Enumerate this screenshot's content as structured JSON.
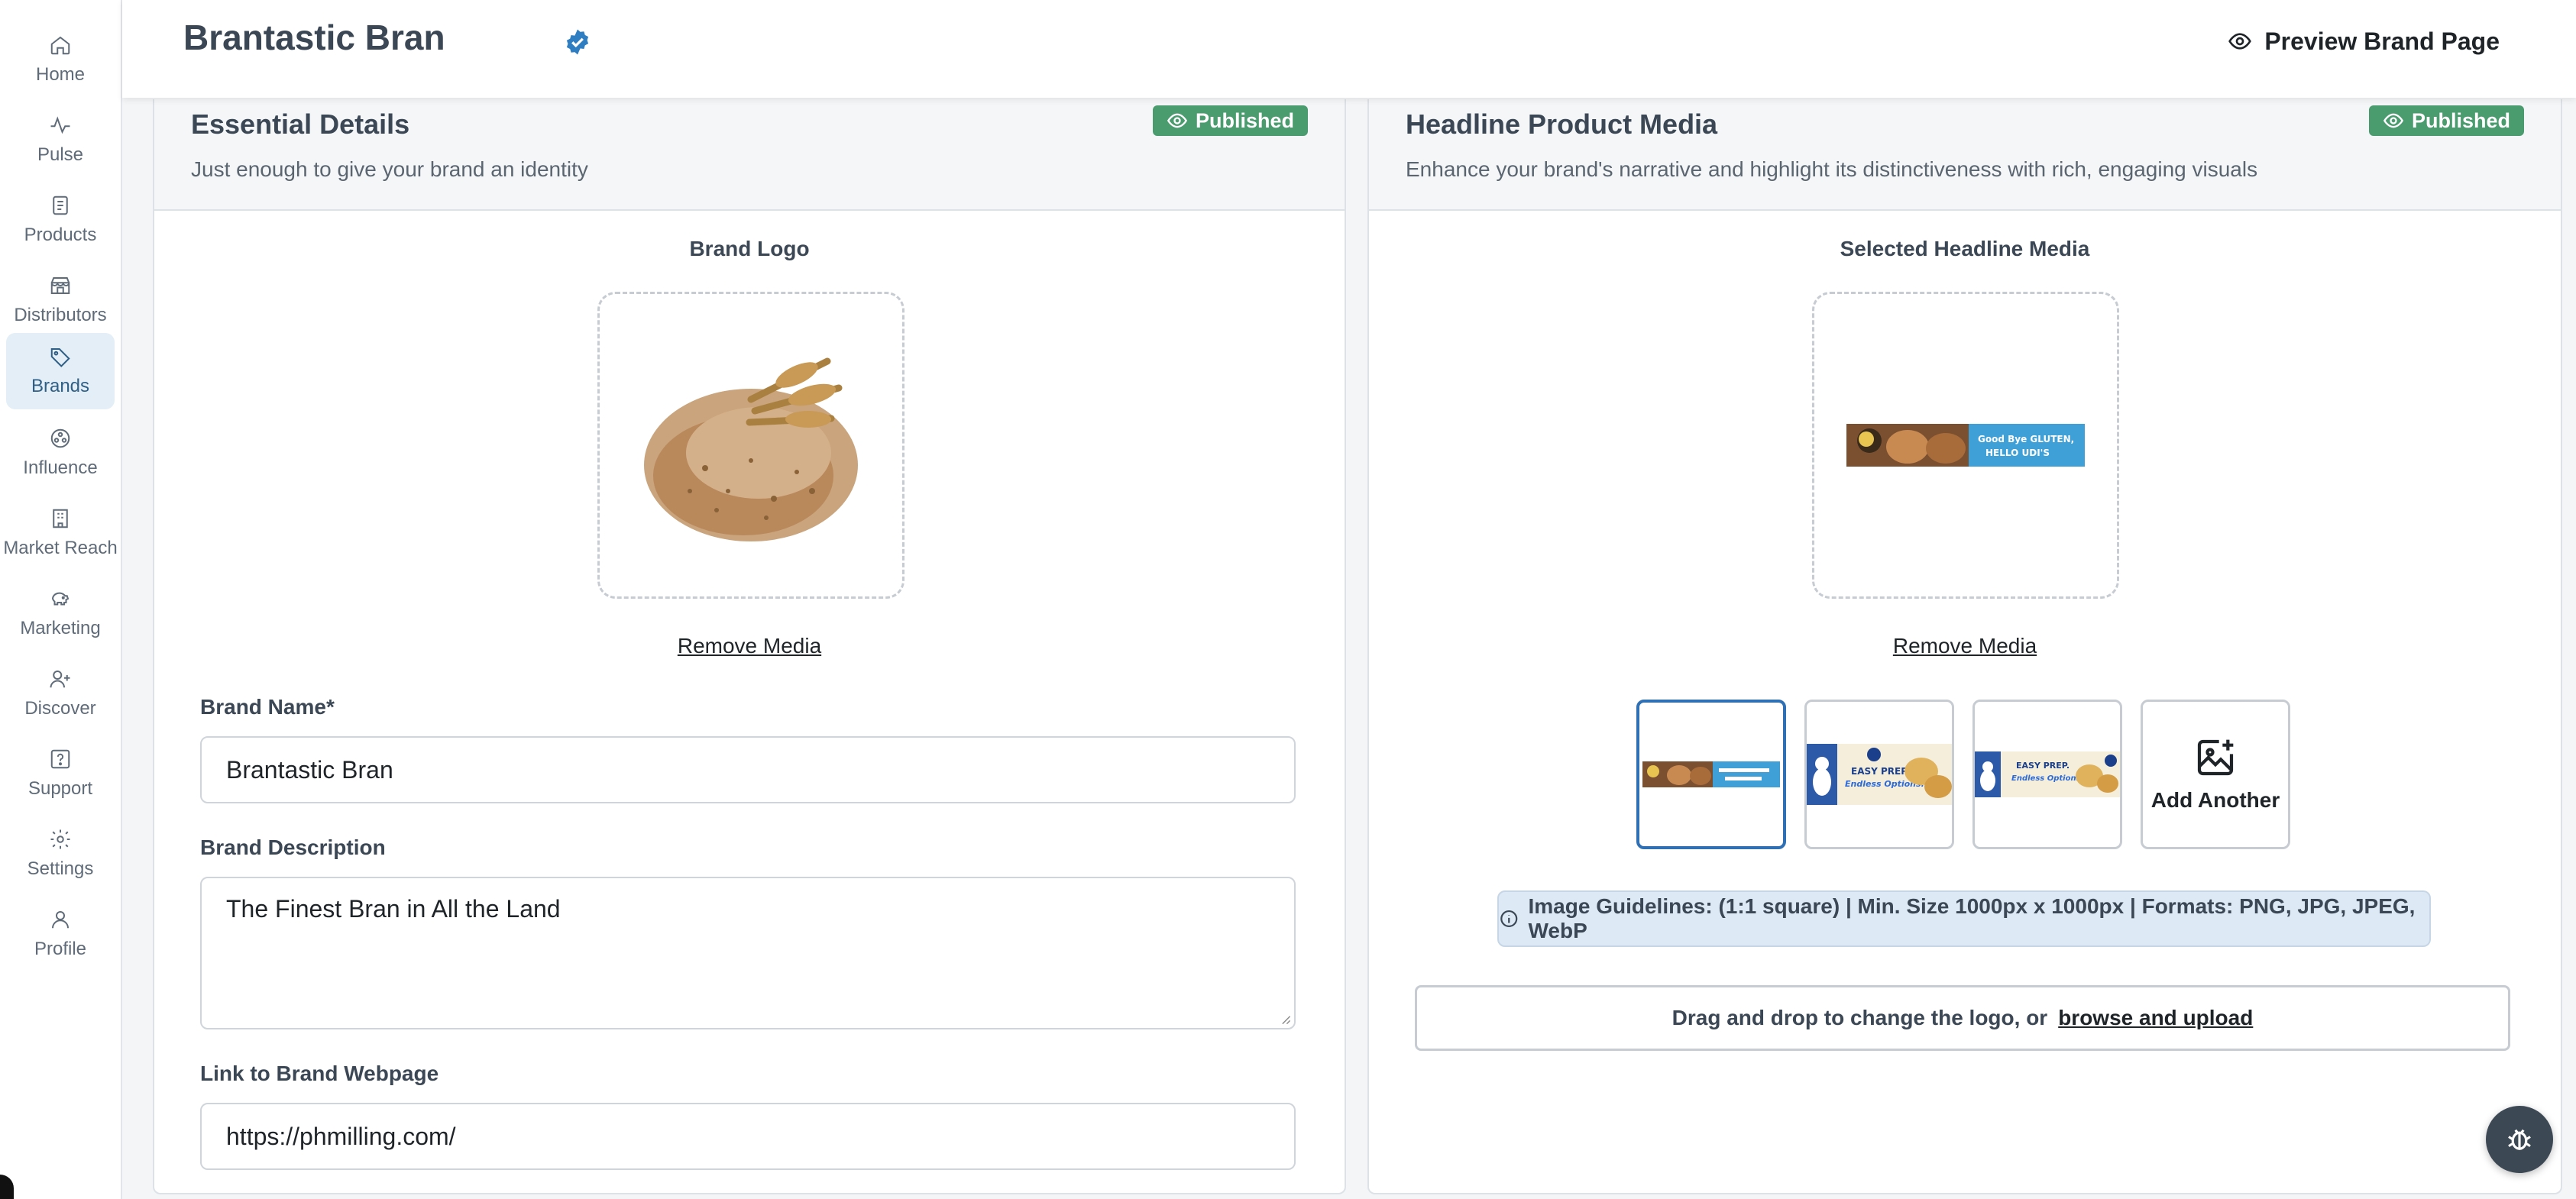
{
  "sidebar": {
    "items": [
      {
        "label": "Home",
        "icon": "home-icon"
      },
      {
        "label": "Pulse",
        "icon": "pulse-icon"
      },
      {
        "label": "Products",
        "icon": "product-box-icon"
      },
      {
        "label": "Distributors",
        "icon": "store-icon"
      },
      {
        "label": "Brands",
        "icon": "tag-icon",
        "active": true
      },
      {
        "label": "Influence",
        "icon": "influence-icon"
      },
      {
        "label": "Market Reach",
        "icon": "building-icon"
      },
      {
        "label": "Marketing",
        "icon": "piggy-bank-icon"
      },
      {
        "label": "Discover",
        "icon": "user-plus-icon"
      },
      {
        "label": "Support",
        "icon": "help-icon"
      },
      {
        "label": "Settings",
        "icon": "gear-icon"
      },
      {
        "label": "Profile",
        "icon": "user-icon"
      }
    ]
  },
  "header": {
    "title": "Brantastic Bran",
    "verified_icon": "verified-badge-icon",
    "preview_label": "Preview Brand Page"
  },
  "essential": {
    "title": "Essential Details",
    "subtitle": "Just enough to give your brand an identity",
    "status": "Published",
    "logo_label": "Brand Logo",
    "remove_label": "Remove Media",
    "brand_name_label": "Brand Name*",
    "brand_name_value": "Brantastic Bran",
    "description_label": "Brand Description",
    "description_value": "The Finest Bran in All the Land",
    "link_label": "Link to Brand Webpage",
    "link_value": "https://phmilling.com/"
  },
  "headline": {
    "title": "Headline Product Media",
    "subtitle": "Enhance your brand's narrative and highlight its distinctiveness with rich, engaging visuals",
    "status": "Published",
    "selected_label": "Selected Headline Media",
    "remove_label": "Remove Media",
    "banner_text_1": "Good Bye GLUTEN,",
    "banner_text_2": "HELLO UDI'S",
    "banner2_line1": "EASY PREP.",
    "banner2_line2": "Endless Options.",
    "add_another_label": "Add Another",
    "guidelines": "Image Guidelines: (1:1 square) | Min. Size 1000px x 1000px | Formats: PNG, JPG, JPEG, WebP",
    "drop_text": "Drag and drop to change the logo, or",
    "browse_label": "browse and upload"
  },
  "colors": {
    "accent": "#2f6fb3",
    "published": "#4a9b6e",
    "active_nav": "#e4eef6"
  }
}
